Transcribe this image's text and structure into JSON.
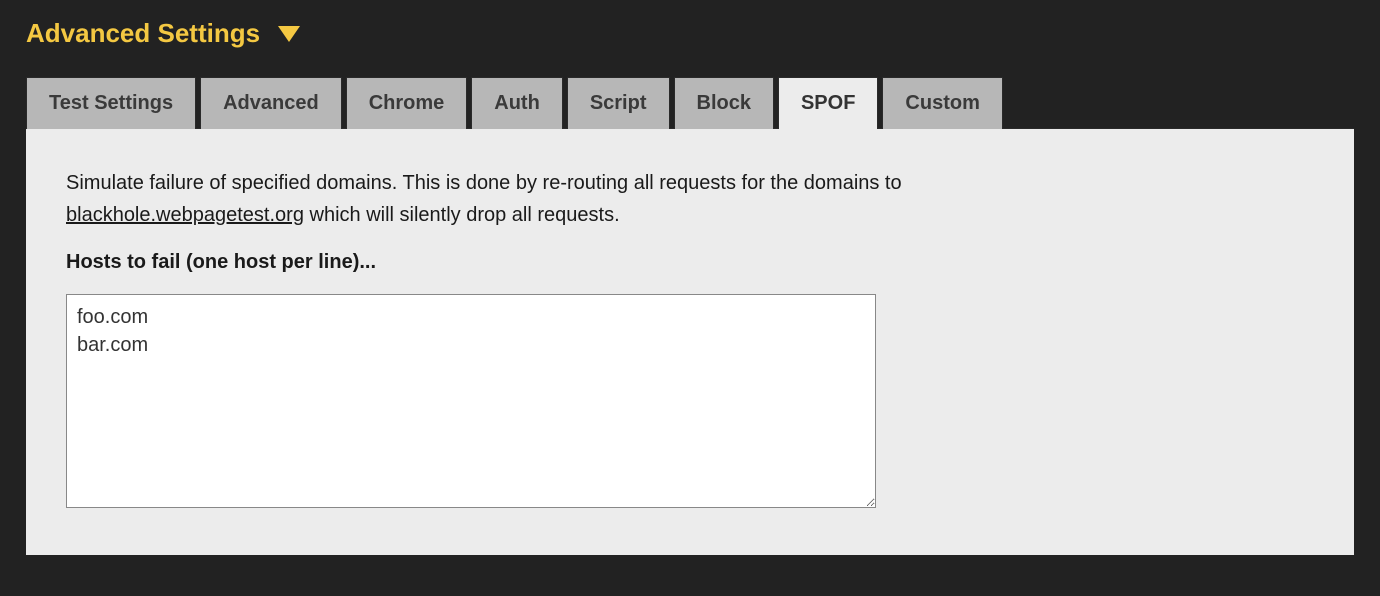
{
  "header": {
    "title": "Advanced Settings"
  },
  "tabs": [
    {
      "label": "Test Settings",
      "active": false
    },
    {
      "label": "Advanced",
      "active": false
    },
    {
      "label": "Chrome",
      "active": false
    },
    {
      "label": "Auth",
      "active": false
    },
    {
      "label": "Script",
      "active": false
    },
    {
      "label": "Block",
      "active": false
    },
    {
      "label": "SPOF",
      "active": true
    },
    {
      "label": "Custom",
      "active": false
    }
  ],
  "panel": {
    "intro_pre": "Simulate failure of specified domains. This is done by re-routing all requests for the domains to ",
    "intro_link": "blackhole.webpagetest.org",
    "intro_post": " which will silently drop all requests.",
    "hosts_label": "Hosts to fail (one host per line)...",
    "hosts_value": "foo.com\nbar.com"
  }
}
